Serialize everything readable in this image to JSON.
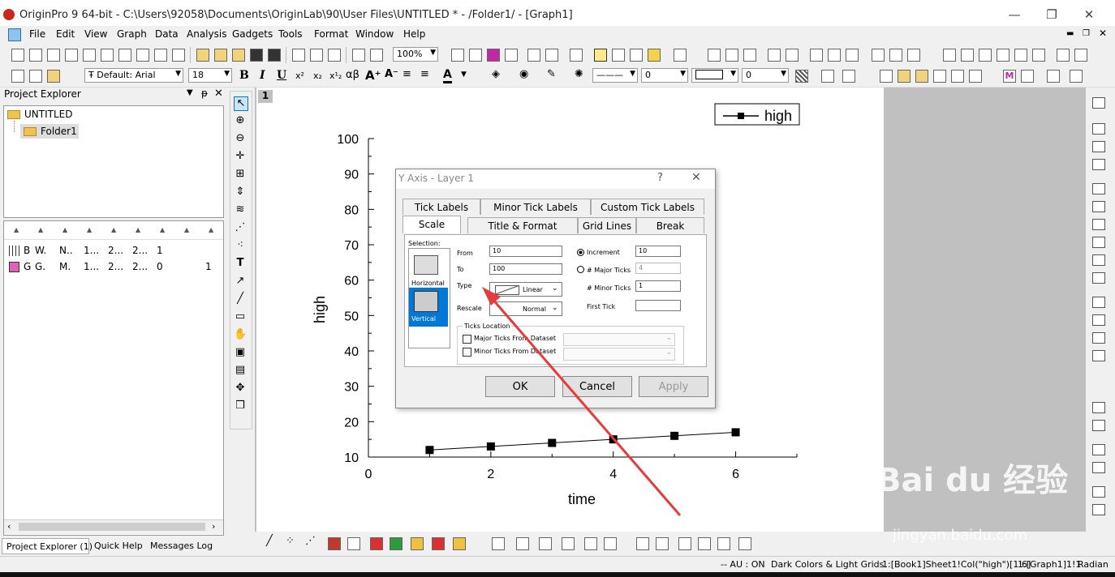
{
  "window": {
    "title": "OriginPro 9 64-bit - C:\\Users\\92058\\Documents\\OriginLab\\90\\User Files\\UNTITLED * - /Folder1/ - [Graph1]",
    "controls": {
      "minimize": "—",
      "restore": "❐",
      "close": "✕"
    }
  },
  "menu": [
    "File",
    "Edit",
    "View",
    "Graph",
    "Data",
    "Analysis",
    "Gadgets",
    "Tools",
    "Format",
    "Window",
    "Help"
  ],
  "toolbar": {
    "zoom": "100%",
    "font": "Default: Arial",
    "font_size": "18",
    "bold": "B",
    "italic": "I",
    "underline": "U",
    "greek": "αβ",
    "line_width": "0",
    "line_width2": "0"
  },
  "project_explorer": {
    "title": "Project Explorer",
    "tree": [
      {
        "label": "UNTITLED"
      },
      {
        "label": "Folder1"
      }
    ],
    "rows": [
      [
        "B",
        "W.",
        "N..",
        "1...",
        "2...",
        "2...",
        "1",
        ""
      ],
      [
        "G",
        "G.",
        "M.",
        "1...",
        "2...",
        "2...",
        "0",
        "1"
      ]
    ],
    "tabs": [
      "Project Explorer (1)",
      "Quick Help",
      "Messages Log"
    ]
  },
  "graph": {
    "page_number": "1",
    "legend": "high"
  },
  "chart_data": {
    "type": "line",
    "title": "",
    "xlabel": "time",
    "ylabel": "high",
    "xlim": [
      0,
      7
    ],
    "ylim": [
      10,
      100
    ],
    "xticks": [
      0,
      2,
      4,
      6
    ],
    "yticks": [
      10,
      20,
      30,
      40,
      50,
      60,
      70,
      80,
      90,
      100
    ],
    "grid": false,
    "legend_position": "top-right",
    "series": [
      {
        "name": "high",
        "x": [
          1,
          2,
          3,
          4,
          5,
          6
        ],
        "y": [
          12,
          13,
          14,
          15,
          16,
          17
        ],
        "color": "#000000"
      }
    ]
  },
  "dialog": {
    "title": "Y Axis - Layer 1",
    "help": "?",
    "close": "✕",
    "tabs_row1": [
      "Tick Labels",
      "Minor Tick Labels",
      "Custom Tick Labels"
    ],
    "tabs_row2": [
      "Scale",
      "Title & Format",
      "Grid Lines",
      "Break"
    ],
    "selection_label": "Selection:",
    "selection_items": [
      "Horizontal",
      "Vertical"
    ],
    "from_label": "From",
    "from_value": "10",
    "to_label": "To",
    "to_value": "100",
    "type_label": "Type",
    "type_value": "Linear",
    "rescale_label": "Rescale",
    "rescale_value": "Normal",
    "increment_label": "Increment",
    "increment_value": "10",
    "major_ticks_label": "# Major Ticks",
    "major_ticks_value": "4",
    "minor_ticks_label": "# Minor Ticks",
    "minor_ticks_value": "1",
    "first_tick_label": "First Tick",
    "first_tick_value": "",
    "ticks_location_label": "Ticks Location",
    "major_from_dataset": "Major Ticks From Dataset",
    "minor_from_dataset": "Minor Ticks From Dataset",
    "ok": "OK",
    "cancel": "Cancel",
    "apply": "Apply"
  },
  "status": {
    "left": "-- AU : ON",
    "theme": "Dark Colors & Light Grids",
    "data": "1:[Book1]Sheet1!Col(\"high\")[1:6]",
    "graph": "1:[Graph1]1!1",
    "angle": "Radian"
  },
  "watermark": {
    "brand": "Bai du 经验",
    "url": "jingyan.baidu.com"
  },
  "colors": {
    "accent": "#0078d7",
    "arrow": "#e83a3a",
    "selection": "#0078d7"
  }
}
